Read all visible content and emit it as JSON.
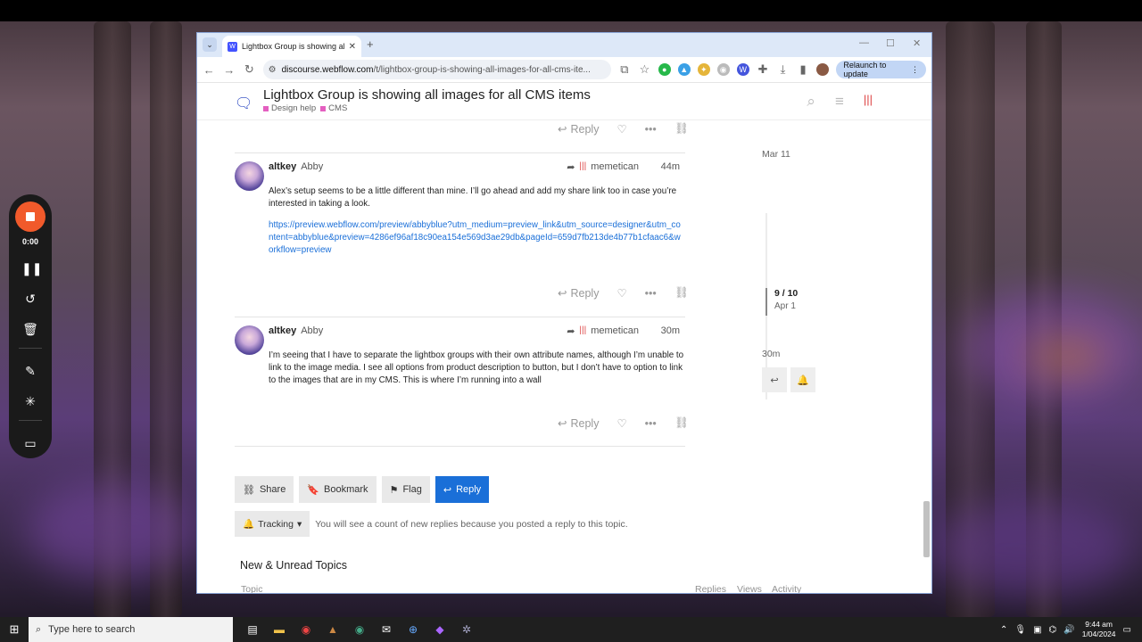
{
  "recorder": {
    "time": "0:00"
  },
  "browser": {
    "tab_title": "Lightbox Group is showing all i",
    "url_host": "discourse.webflow.com",
    "url_path": "/t/lightbox-group-is-showing-all-images-for-all-cms-ite...",
    "relaunch_label": "Relaunch to update"
  },
  "header": {
    "title": "Lightbox Group is showing all images for all CMS items",
    "categories": [
      {
        "label": "Design help",
        "color": "#e45fc0"
      },
      {
        "label": "CMS",
        "color": "#e45fc0"
      }
    ]
  },
  "actions": {
    "reply_label": "Reply"
  },
  "posts": [
    {
      "username": "altkey",
      "fullname": "Abby",
      "reply_to": "memetican",
      "time": "44m",
      "body": "Alex’s setup seems to be a little different than mine. I’ll go ahead and add my share link too in case you’re interested in taking a look.",
      "link": "https://preview.webflow.com/preview/abbyblue?utm_medium=preview_link&utm_source=designer&utm_content=abbyblue&preview=4286ef96af18c90ea154e569d3ae29db&pageId=659d7fb213de4b77b1cfaac6&workflow=preview"
    },
    {
      "username": "altkey",
      "fullname": "Abby",
      "reply_to": "memetican",
      "time": "30m",
      "body": "I’m seeing that I have to separate the lightbox groups with their own attribute names, although I’m unable to link to the image media. I see all options from product description to button, but I don’t have to option to link to the images that are in my CMS. This is where I’m running into a wall",
      "link": ""
    }
  ],
  "timeline": {
    "top_date": "Mar 11",
    "position": "9 / 10",
    "position_date": "Apr 1",
    "bottom_date": "30m"
  },
  "footer_buttons": {
    "share": "Share",
    "bookmark": "Bookmark",
    "flag": "Flag",
    "reply": "Reply"
  },
  "tracking": {
    "label": "Tracking",
    "text": "You will see a count of new replies because you posted a reply to this topic."
  },
  "suggested": {
    "heading": "New & Unread Topics",
    "col_topic": "Topic",
    "col_replies": "Replies",
    "col_views": "Views",
    "col_activity": "Activity"
  },
  "taskbar": {
    "search_placeholder": "Type here to search",
    "time": "9:44 am",
    "date": "1/04/2024"
  }
}
